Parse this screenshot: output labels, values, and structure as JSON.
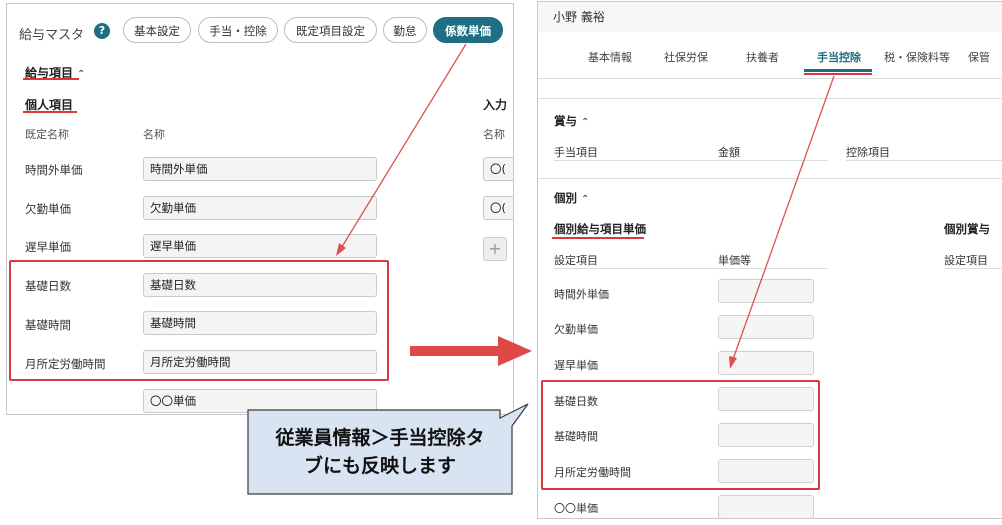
{
  "left": {
    "title": "給与マスタ",
    "help_icon": "?",
    "tabs": [
      {
        "label": "基本設定"
      },
      {
        "label": "手当・控除"
      },
      {
        "label": "既定項目設定"
      },
      {
        "label": "勤怠"
      },
      {
        "label": "係数単価"
      }
    ],
    "section": "給与項目",
    "subsection": "個人項目",
    "col_default_name": "既定名称",
    "col_name": "名称",
    "col_input_clip": "入力",
    "col_name_clip": "名称",
    "rows": [
      {
        "label": "時間外単価",
        "value": "時間外単価"
      },
      {
        "label": "欠勤単価",
        "value": "欠勤単価"
      },
      {
        "label": "遅早単価",
        "value": "遅早単価"
      },
      {
        "label": "基礎日数",
        "value": "基礎日数"
      },
      {
        "label": "基礎時間",
        "value": "基礎時間"
      },
      {
        "label": "月所定労働時間",
        "value": "月所定労働時間"
      },
      {
        "label": "",
        "value": "〇〇単価"
      }
    ],
    "right_field_prefix": "〇(",
    "plus": "+"
  },
  "right": {
    "employee_name": "小野 義裕",
    "tabs": [
      {
        "label": "基本情報"
      },
      {
        "label": "社保労保"
      },
      {
        "label": "扶養者"
      },
      {
        "label": "手当控除"
      },
      {
        "label": "税・保険料等"
      },
      {
        "label": "保管"
      }
    ],
    "bonus_section": "賞与",
    "col_allowance": "手当項目",
    "col_amount": "金額",
    "col_deduction": "控除項目",
    "individual_section": "個別",
    "individual_unit_title": "個別給与項目単価",
    "individual_bonus_clip": "個別賞与",
    "col_setting_item": "設定項目",
    "col_unit_price": "単価等",
    "col_setting_item2": "設定項目",
    "rows": [
      {
        "label": "時間外単価"
      },
      {
        "label": "欠勤単価"
      },
      {
        "label": "遅早単価"
      },
      {
        "label": "基礎日数"
      },
      {
        "label": "基礎時間"
      },
      {
        "label": "月所定労働時間"
      },
      {
        "label": "〇〇単価"
      }
    ]
  },
  "callout": {
    "line1": "従業員情報＞手当控除タ",
    "line2": "ブにも反映します"
  },
  "colors": {
    "accent": "#1f6f84",
    "annotation_red": "#d63a3a",
    "callout_fill": "#d9e4f2",
    "callout_border": "#3a3a3a"
  }
}
